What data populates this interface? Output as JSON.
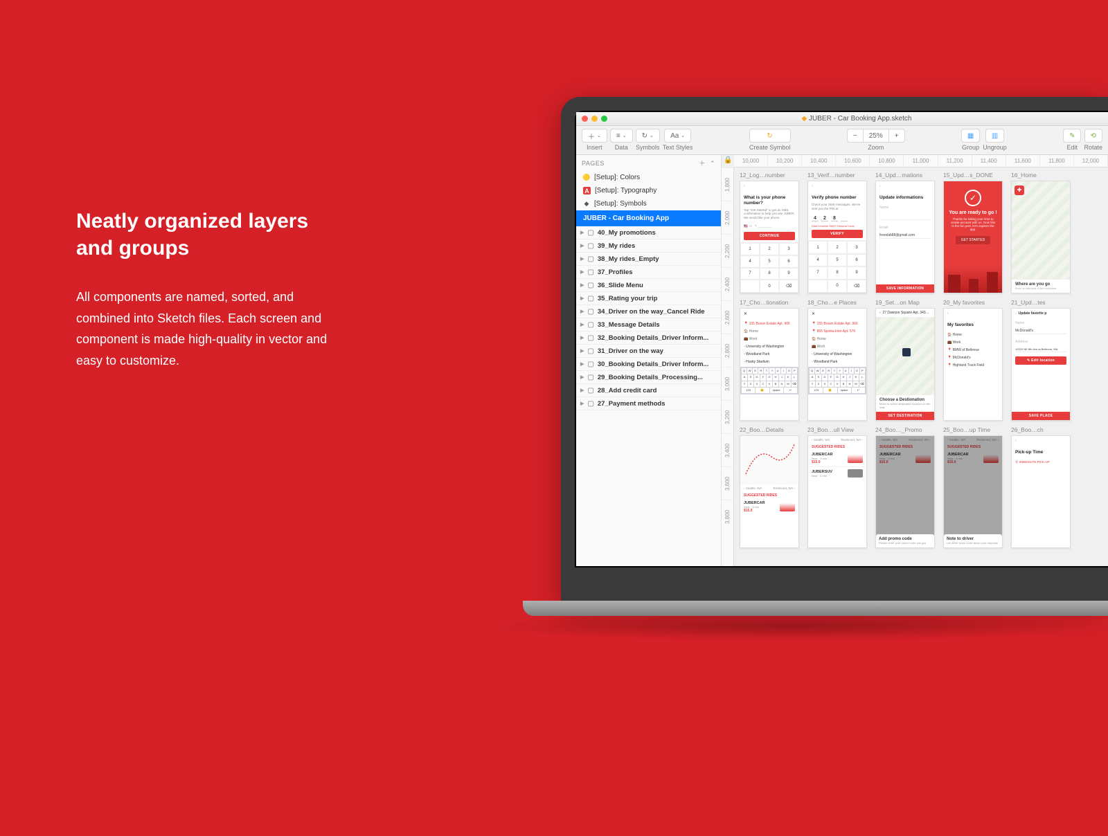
{
  "marketing": {
    "heading": "Neatly organized layers and groups",
    "body": "All components are named, sorted, and combined into Sketch files. Each screen and component is made high-quality in vector and easy to customize."
  },
  "window": {
    "title": "JUBER - Car Booking App.sketch"
  },
  "toolbar": {
    "insert": "Insert",
    "data": "Data",
    "symbols": "Symbols",
    "text_styles": "Text Styles",
    "create_symbol": "Create Symbol",
    "zoom": "Zoom",
    "zoom_value": "25%",
    "group": "Group",
    "ungroup": "Ungroup",
    "edit": "Edit",
    "rotate": "Rotate"
  },
  "pages": {
    "label": "PAGES",
    "items": [
      {
        "name": "[Setup]: Colors"
      },
      {
        "name": "[Setup]: Typography"
      },
      {
        "name": "[Setup]: Symbols"
      }
    ],
    "selected": "JUBER - Car Booking App"
  },
  "layers": [
    "40_My promotions",
    "39_My rides",
    "38_My rides_Empty",
    "37_Profiles",
    "36_Slide Menu",
    "35_Rating your trip",
    "34_Driver on the way_Cancel Ride",
    "33_Message Details",
    "32_Booking Details_Driver Inform...",
    "31_Driver on the way",
    "30_Booking Details_Driver Inform...",
    "29_Booking Details_Processing...",
    "28_Add credit card",
    "27_Payment methods"
  ],
  "ruler_h": [
    "10,000",
    "10,200",
    "10,400",
    "10,600",
    "10,800",
    "11,000",
    "11,200",
    "11,400",
    "11,600",
    "11,800",
    "12,000"
  ],
  "ruler_v": [
    "1,800",
    "2,000",
    "2,200",
    "2,400",
    "2,600",
    "2,800",
    "3,000",
    "3,200",
    "3,400",
    "3,600",
    "3,800"
  ],
  "artboards": {
    "row1": [
      {
        "title": "12_Log…number",
        "h": "What is your phone number?",
        "sub": "Tap \"Get Started\" to get an SMS confirmation to help you use JUBER. We would like your phone",
        "btn": "CONTINUE"
      },
      {
        "title": "13_Verif…number",
        "h": "Verify phone number",
        "sub": "Check your SMS messages. We've sent you the PIN at",
        "btn": "VERIFY",
        "codes": [
          "4",
          "2",
          "8",
          ""
        ]
      },
      {
        "title": "14_Upd…mations",
        "h": "Update informations",
        "btn": "SAVE INFORMATION"
      },
      {
        "title": "15_Upd…s_DONE",
        "h": "You are ready to go !",
        "sub": "Thanks for taking your time to create account with us. Now this is the fun part, let's explore the app.",
        "btn": "GET STARTED"
      },
      {
        "title": "16_Home",
        "h": "Where are you go"
      }
    ],
    "row2": [
      {
        "title": "17_Cho…tionation",
        "items": [
          "155 Brown Estate Apt. 966",
          "Home",
          "Work",
          "University of Washington",
          "Woodland Park",
          "Husky Stadium"
        ]
      },
      {
        "title": "18_Cho…e Places",
        "items": [
          "155 Brown Estate Apt. 966",
          "855 Spinka Inlet Apt. 576",
          "Home",
          "Work",
          "University of Washington",
          "Woodland Park"
        ]
      },
      {
        "title": "19_Set…on Map",
        "h": "Choose a Destionation",
        "addr": "27 Dawson Square Apt. 343…",
        "btn": "SET DESTINATION"
      },
      {
        "title": "20_My favorites",
        "h": "My favorites",
        "items": [
          "Home",
          "Work",
          "BMW of Bellevue",
          "McDonald's",
          "Highland Track Field"
        ]
      },
      {
        "title": "21_Upd…tes",
        "h": "Update favorite p",
        "btn": "SAVE PLACE"
      }
    ],
    "row3": [
      {
        "title": "22_Boo…Details"
      },
      {
        "title": "23_Boo…ull View"
      },
      {
        "title": "24_Boo…_Promo",
        "modal": "Add promo code"
      },
      {
        "title": "25_Boo…up Time",
        "modal": "Note to driver"
      },
      {
        "title": "26_Boo…ch",
        "h": "Pick-up Time"
      }
    ]
  }
}
